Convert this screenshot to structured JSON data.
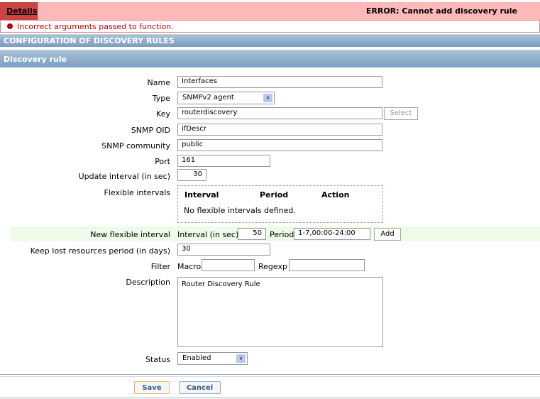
{
  "error": {
    "details_label": "Details",
    "title": "ERROR: Cannot add discovery rule",
    "message": "Incorrect arguments passed to function."
  },
  "section_title": "CONFIGURATION OF DISCOVERY RULES",
  "form_title": "Discovery rule",
  "fields": {
    "name": {
      "label": "Name",
      "value": "Interfaces"
    },
    "type": {
      "label": "Type",
      "value": "SNMPv2 agent"
    },
    "key": {
      "label": "Key",
      "value": "routerdiscovery",
      "button": "Select"
    },
    "snmp_oid": {
      "label": "SNMP OID",
      "value": "ifDescr"
    },
    "snmp_community": {
      "label": "SNMP community",
      "value": "public"
    },
    "port": {
      "label": "Port",
      "value": "161"
    },
    "update_interval": {
      "label": "Update interval (in sec)",
      "value": "30"
    },
    "flexible": {
      "label": "Flexible intervals",
      "columns": [
        "Interval",
        "Period",
        "Action"
      ],
      "empty": "No flexible intervals defined."
    },
    "new_flexible": {
      "label": "New flexible interval",
      "interval_label": "Interval (in sec)",
      "interval_value": "50",
      "period_label": "Period",
      "period_value": "1-7,00:00-24:00",
      "add": "Add"
    },
    "keep_lost": {
      "label": "Keep lost resources period (in days)",
      "value": "30"
    },
    "filter": {
      "label": "Filter",
      "macro_label": "Macro",
      "macro_value": "",
      "regexp_label": "Regexp",
      "regexp_value": ""
    },
    "description": {
      "label": "Description",
      "value": "Router Discovery Rule"
    },
    "status": {
      "label": "Status",
      "value": "Enabled"
    }
  },
  "buttons": {
    "save": "Save",
    "cancel": "Cancel"
  }
}
